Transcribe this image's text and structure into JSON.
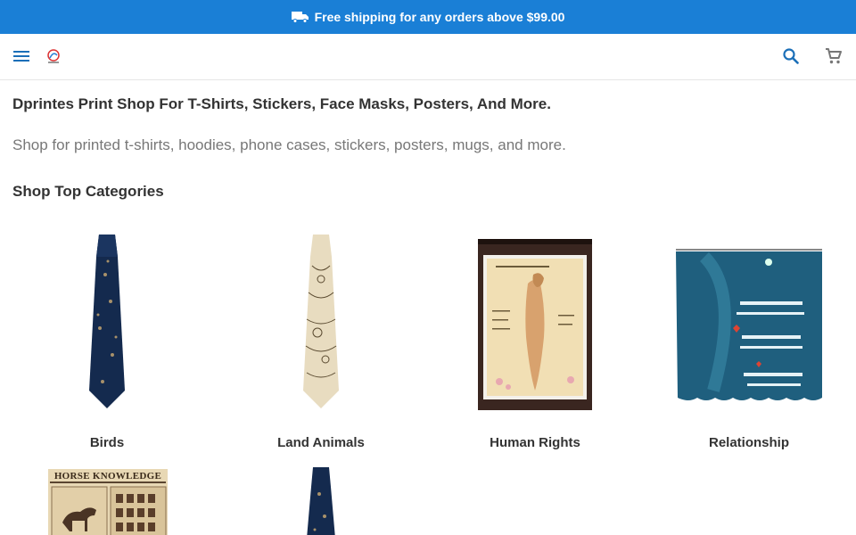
{
  "promo": {
    "text": "Free shipping for any orders above $99.00",
    "icon": "truck-icon"
  },
  "header": {
    "menu_icon": "hamburger-menu-icon",
    "logo": "logo",
    "search_icon": "search-icon",
    "cart_icon": "cart-icon"
  },
  "main": {
    "title": "Dprintes Print Shop For T-Shirts, Stickers, Face Masks, Posters, And More.",
    "description": "Shop for printed t-shirts, hoodies, phone cases, stickers, posters, mugs, and more.",
    "section_title": "Shop Top Categories",
    "categories": [
      {
        "label": "Birds"
      },
      {
        "label": "Land Animals"
      },
      {
        "label": "Human Rights"
      },
      {
        "label": "Relationship"
      },
      {
        "label": ""
      },
      {
        "label": ""
      }
    ],
    "poster_heading": "HORSE KNOWLEDGE"
  },
  "colors": {
    "promo_bar": "#1a7fd6",
    "icon_blue": "#1b6fb8",
    "text": "#333333",
    "muted": "#777777"
  }
}
